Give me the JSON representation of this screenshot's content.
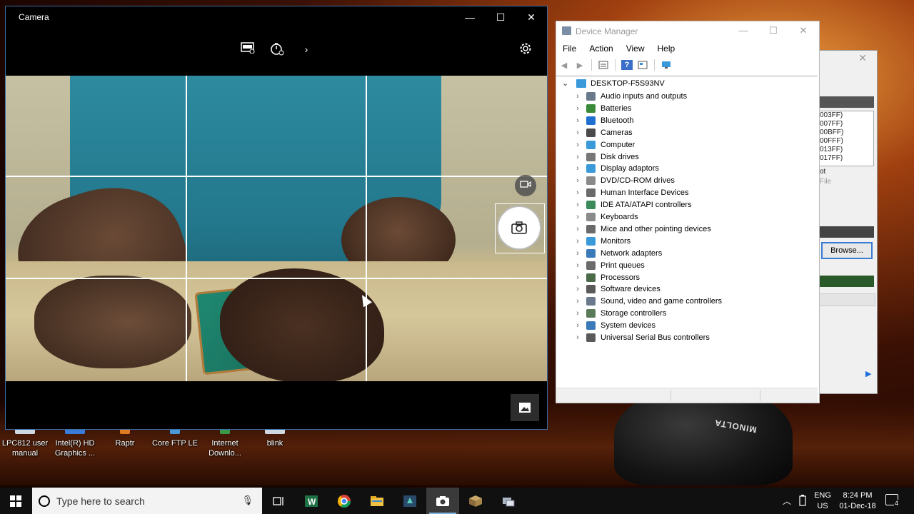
{
  "desktop": {
    "icons": [
      {
        "label": "LPC812 user manual"
      },
      {
        "label": "Intel(R) HD Graphics ..."
      },
      {
        "label": "Raptr"
      },
      {
        "label": "Core FTP LE"
      },
      {
        "label": "Internet Downlo..."
      },
      {
        "label": "blink"
      }
    ],
    "projector_brand": "MINOLTA"
  },
  "camera": {
    "title": "Camera",
    "toolbar": {
      "hdr": "HDR",
      "timer_icon": "timer-icon",
      "more": "›",
      "settings_icon": "gear-icon"
    },
    "grid": "rule-of-thirds"
  },
  "background_dialog": {
    "list": [
      "003FF)",
      "007FF)",
      "00BFF)",
      "00FFF)",
      "013FF)",
      "017FF)"
    ],
    "text1": "ot",
    "text2": "File",
    "browse_label": "Browse..."
  },
  "device_manager": {
    "title": "Device Manager",
    "menu": [
      "File",
      "Action",
      "View",
      "Help"
    ],
    "root": "DESKTOP-F5S93NV",
    "items": [
      {
        "label": "Audio inputs and outputs",
        "icon": "speaker-icon",
        "color": "#6a7a8c"
      },
      {
        "label": "Batteries",
        "icon": "battery-icon",
        "color": "#3a8a3a"
      },
      {
        "label": "Bluetooth",
        "icon": "bluetooth-icon",
        "color": "#1e6fd0"
      },
      {
        "label": "Cameras",
        "icon": "camera-icon",
        "color": "#4a4a4a"
      },
      {
        "label": "Computer",
        "icon": "monitor-icon",
        "color": "#3a9ad9"
      },
      {
        "label": "Disk drives",
        "icon": "disk-icon",
        "color": "#777777"
      },
      {
        "label": "Display adaptors",
        "icon": "display-adapter-icon",
        "color": "#3a9ad9"
      },
      {
        "label": "DVD/CD-ROM drives",
        "icon": "dvd-icon",
        "color": "#8a8a8a"
      },
      {
        "label": "Human Interface Devices",
        "icon": "hid-icon",
        "color": "#6a6a6a"
      },
      {
        "label": "IDE ATA/ATAPI controllers",
        "icon": "ide-icon",
        "color": "#3a8a5a"
      },
      {
        "label": "Keyboards",
        "icon": "keyboard-icon",
        "color": "#8a8a8a"
      },
      {
        "label": "Mice and other pointing devices",
        "icon": "mouse-icon",
        "color": "#6a6a6a"
      },
      {
        "label": "Monitors",
        "icon": "monitor-icon",
        "color": "#3a9ad9"
      },
      {
        "label": "Network adapters",
        "icon": "network-icon",
        "color": "#3a7ab9"
      },
      {
        "label": "Print queues",
        "icon": "printer-icon",
        "color": "#6a6a6a"
      },
      {
        "label": "Processors",
        "icon": "processor-icon",
        "color": "#4a6a4a"
      },
      {
        "label": "Software devices",
        "icon": "software-device-icon",
        "color": "#5a5a5a"
      },
      {
        "label": "Sound, video and game controllers",
        "icon": "sound-icon",
        "color": "#6a7a8c"
      },
      {
        "label": "Storage controllers",
        "icon": "storage-icon",
        "color": "#5a7a5a"
      },
      {
        "label": "System devices",
        "icon": "system-device-icon",
        "color": "#3a7ab9"
      },
      {
        "label": "Universal Serial Bus controllers",
        "icon": "usb-icon",
        "color": "#5a5a5a"
      }
    ]
  },
  "taskbar": {
    "search_placeholder": "Type here to search",
    "apps": [
      "task-view-icon",
      "excel-icon",
      "chrome-icon",
      "file-explorer-icon",
      "app-icon",
      "camera-icon",
      "package-icon",
      "network-icon"
    ],
    "active_app": "camera-icon",
    "lang": {
      "line1": "ENG",
      "line2": "US"
    },
    "time": "8:24 PM",
    "date": "01-Dec-18",
    "notification_count": "4"
  }
}
